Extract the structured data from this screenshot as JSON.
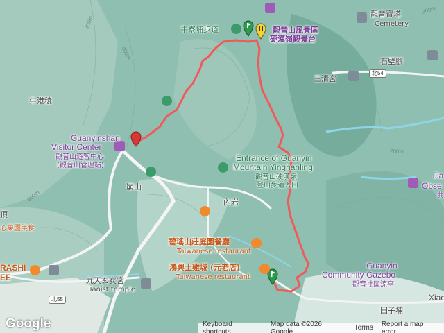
{
  "places": {
    "trail_niuliao": "牛寮埔步道",
    "scenic_area_line1": "觀音山風景區",
    "scenic_area_line2": "硬漢嶺觀景台",
    "pagoda_zh": "觀音寶塔",
    "pagoda_en": "Cemetery",
    "shibijiao": "石壁腳",
    "sanqing": "三清宮",
    "niugangleng": "牛港稜",
    "visitor_en1": "Guanyinshan",
    "visitor_en2": "Visitor Center",
    "visitor_zh1": "觀音山遊客中心",
    "visitor_zh2": "(觀音山管理站)",
    "entrance_en1": "Entrance of Guanyin",
    "entrance_en2": "Mountain Yinghanling",
    "entrance_zh1": "觀音山硬漢嶺",
    "entrance_zh2": "登山步道入口",
    "bengshan": "崩山",
    "neiyan": "內岩",
    "bilu_zh": "碧瑤山莊庭園餐廳",
    "bilu_en": "Taiwanese restaurant",
    "hongxing_zh": "鴻興土雞城 (元老店)",
    "hongxing_en": "Taiwanese restaurant",
    "jiutian_zh": "九天玄女宮",
    "jiutian_en": "Taoist temple",
    "gazebo_en1": "Guanyin",
    "gazebo_en2": "Community Gazebo",
    "gazebo_zh": "觀音社區涼亭",
    "tianzipu": "田子埔",
    "xiao": "Xiao",
    "jia": "Jia",
    "obse": "Obse",
    "jia_zh": "共",
    "ding": "頂",
    "fruit": "心果園美食",
    "arashi": "RASHI",
    "ee": "EE"
  },
  "roads": {
    "north54": "北54",
    "north55": "北55"
  },
  "contours": {
    "c300a": "300m",
    "c400": "400m",
    "c300b": "300m",
    "c200": "200m",
    "c300c": "300m"
  },
  "footer": {
    "keyboard": "Keyboard shortcuts",
    "mapdata": "Map data ©2026 Google",
    "terms": "Terms",
    "report": "Report a map error"
  },
  "brand": "Google",
  "colors": {
    "route": "#ef5a5a",
    "terrain": "#8fbfb0",
    "water": "#8fd5e8",
    "pin_green": "#3c9b6a",
    "pin_purple": "#a05ab8",
    "pin_orange": "#f08a2c"
  }
}
